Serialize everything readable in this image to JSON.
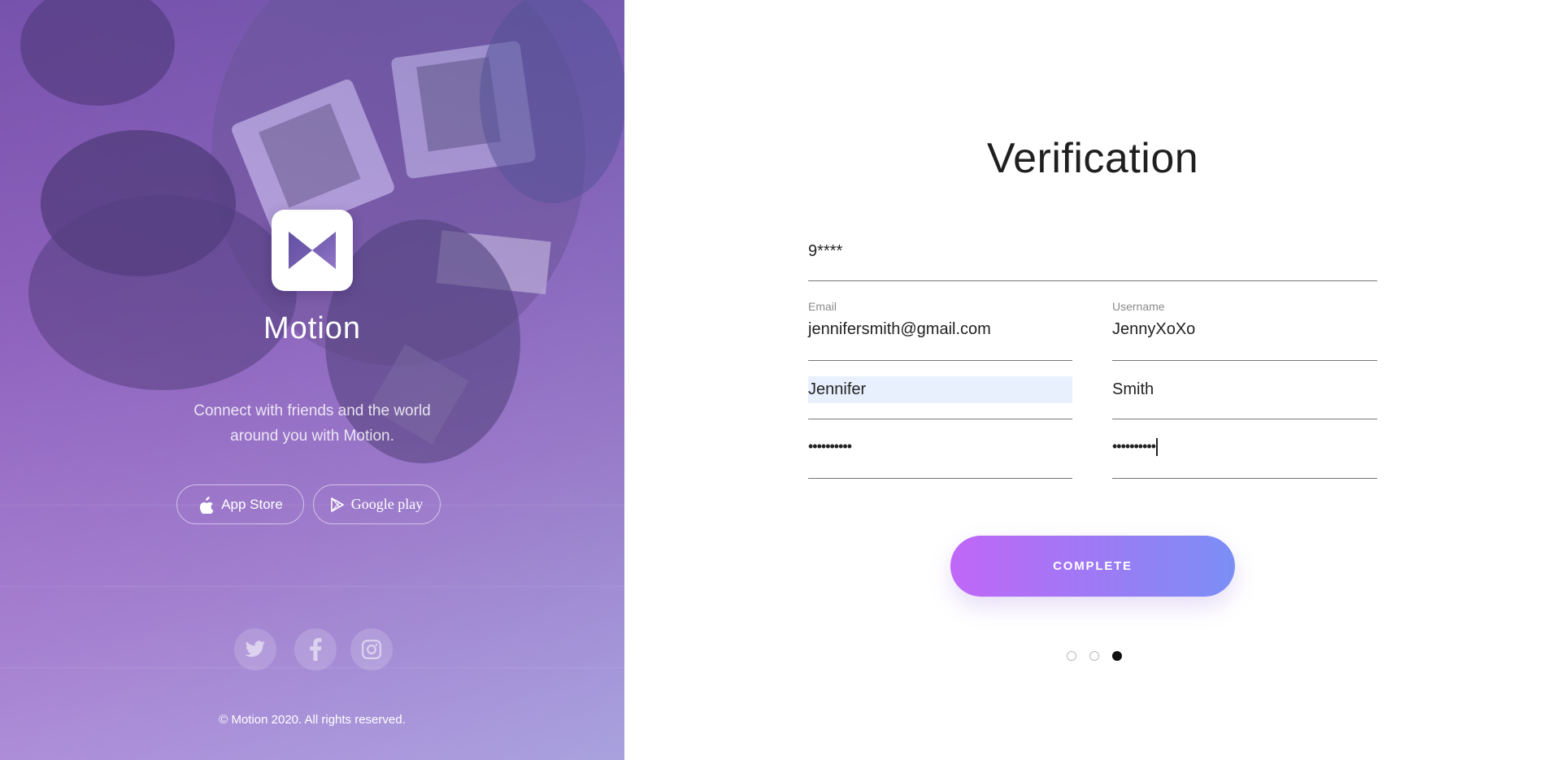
{
  "brand": {
    "name": "Motion",
    "tagline_line1": "Connect with friends and the world",
    "tagline_line2": "around you with Motion.",
    "logo_icon": "motion-bowtie-icon"
  },
  "stores": {
    "apple_label": "App Store",
    "google_label": "Google play"
  },
  "social": [
    "twitter-icon",
    "facebook-icon",
    "instagram-icon"
  ],
  "footer": {
    "copyright": "© Motion 2020. All rights reserved."
  },
  "form": {
    "title": "Verification",
    "code_value": "9****",
    "email_label": "Email",
    "email_value": "jennifersmith@gmail.com",
    "username_label": "Username",
    "username_value": "JennyXoXo",
    "first_name_value": "Jennifer",
    "last_name_value": "Smith",
    "password_value": "••••••••••",
    "confirm_password_value": "••••••••••",
    "submit_label": "COMPLETE"
  },
  "pagination": {
    "total": 3,
    "current": 3
  },
  "colors": {
    "button_gradient_start": "#c067f7",
    "button_gradient_end": "#7b8ff5",
    "autofill_highlight": "#e8f0fe"
  }
}
